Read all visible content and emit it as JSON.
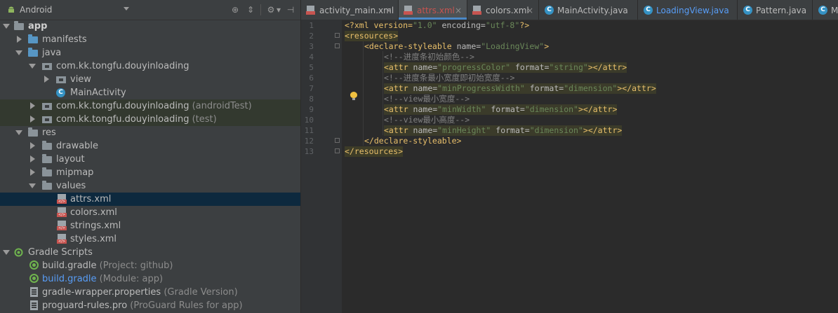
{
  "project_panel": {
    "view_mode": "Android",
    "toolbar_icons": [
      "target-icon",
      "collapse-icon",
      "gear-icon",
      "hide-icon"
    ],
    "tree": [
      {
        "label": "app",
        "suffix": "",
        "bold": true,
        "expanded": true,
        "icon": "module-folder-icon"
      },
      {
        "label": "manifests",
        "suffix": "",
        "expanded": false,
        "icon": "folder-blue-icon"
      },
      {
        "label": "java",
        "suffix": "",
        "expanded": true,
        "icon": "folder-blue-icon"
      },
      {
        "label": "com.kk.tongfu.douyinloading",
        "suffix": "",
        "expanded": true,
        "icon": "package-icon"
      },
      {
        "label": "view",
        "suffix": "",
        "expanded": false,
        "icon": "package-icon"
      },
      {
        "label": "MainActivity",
        "suffix": "",
        "icon": "class-icon"
      },
      {
        "label": "com.kk.tongfu.douyinloading",
        "suffix": "(androidTest)",
        "expanded": false,
        "icon": "package-icon"
      },
      {
        "label": "com.kk.tongfu.douyinloading",
        "suffix": "(test)",
        "expanded": false,
        "icon": "package-icon"
      },
      {
        "label": "res",
        "suffix": "",
        "expanded": true,
        "icon": "folder-icon"
      },
      {
        "label": "drawable",
        "suffix": "",
        "expanded": false,
        "icon": "folder-icon"
      },
      {
        "label": "layout",
        "suffix": "",
        "expanded": false,
        "icon": "folder-icon"
      },
      {
        "label": "mipmap",
        "suffix": "",
        "expanded": false,
        "icon": "folder-icon"
      },
      {
        "label": "values",
        "suffix": "",
        "expanded": true,
        "icon": "folder-icon"
      },
      {
        "label": "attrs.xml",
        "suffix": "",
        "icon": "xml-file-icon",
        "selected": true
      },
      {
        "label": "colors.xml",
        "suffix": "",
        "icon": "xml-file-icon"
      },
      {
        "label": "strings.xml",
        "suffix": "",
        "icon": "xml-file-icon"
      },
      {
        "label": "styles.xml",
        "suffix": "",
        "icon": "xml-file-icon"
      },
      {
        "label": "Gradle Scripts",
        "suffix": "",
        "expanded": true,
        "icon": "gradle-scripts-icon"
      },
      {
        "label": "build.gradle",
        "suffix": "(Project: github)",
        "icon": "gradle-icon"
      },
      {
        "label": "build.gradle",
        "suffix": "(Module: app)",
        "icon": "gradle-icon",
        "link": true
      },
      {
        "label": "gradle-wrapper.properties",
        "suffix": "(Gradle Version)",
        "icon": "properties-icon"
      },
      {
        "label": "proguard-rules.pro",
        "suffix": "(ProGuard Rules for app)",
        "icon": "properties-icon"
      }
    ]
  },
  "editor": {
    "tabs": [
      {
        "label": "activity_main.xml",
        "icon": "xml-file-icon",
        "active": false
      },
      {
        "label": "attrs.xml",
        "icon": "xml-file-icon",
        "active": true
      },
      {
        "label": "colors.xml",
        "icon": "xml-file-icon",
        "active": false
      },
      {
        "label": "MainActivity.java",
        "icon": "class-icon",
        "active": false
      },
      {
        "label": "LoadingView.java",
        "icon": "class-icon",
        "active": false
      },
      {
        "label": "Pattern.java",
        "icon": "class-icon",
        "active": false
      },
      {
        "label": "Mai",
        "icon": "class-icon",
        "active": false
      }
    ],
    "close_glyph": "×",
    "line_numbers": [
      "1",
      "2",
      "3",
      "4",
      "5",
      "6",
      "7",
      "8",
      "9",
      "10",
      "11",
      "12",
      "13"
    ],
    "code": {
      "l1_a": "<?xml version=",
      "l1_b": "\"1.0\"",
      "l1_c": " encoding=",
      "l1_d": "\"utf-8\"",
      "l1_e": "?>",
      "l2": "<resources>",
      "l3_a": "<declare-styleable ",
      "l3_b": "name=",
      "l3_c": "\"LoadingView\"",
      "l3_d": ">",
      "l4": "<!--进度条初始颜色-->",
      "l5_a": "<attr ",
      "l5_b": "name=",
      "l5_c": "\"progressColor\"",
      "l5_d": " format=",
      "l5_e": "\"string\"",
      "l5_f": "></attr>",
      "l6": "<!--进度条最小宽度即初始宽度-->",
      "l7_a": "<attr ",
      "l7_b": "name=",
      "l7_c": "\"minProgressWidth\"",
      "l7_d": " format=",
      "l7_e": "\"dimension\"",
      "l7_f": "></attr>",
      "l8": "<!--view最小宽度-->",
      "l9_a": "<attr ",
      "l9_b": "name=",
      "l9_c": "\"minWidth\"",
      "l9_d": " format=",
      "l9_e": "\"dimension\"",
      "l9_f": "></attr>",
      "l10": "<!--view最小高度-->",
      "l11_a": "<attr ",
      "l11_b": "name=",
      "l11_c": "\"minHeight\"",
      "l11_d": " format=",
      "l11_e": "\"dimension\"",
      "l11_f": "></attr>",
      "l12": "</declare-styleable>",
      "l13": "</resources>"
    }
  },
  "colors": {
    "tag": "#e8bf6a",
    "attribute": "#bababa",
    "string": "#6a8759",
    "comment": "#808080",
    "selection": "#0d293e",
    "tab_underline": "#4a88c7"
  }
}
